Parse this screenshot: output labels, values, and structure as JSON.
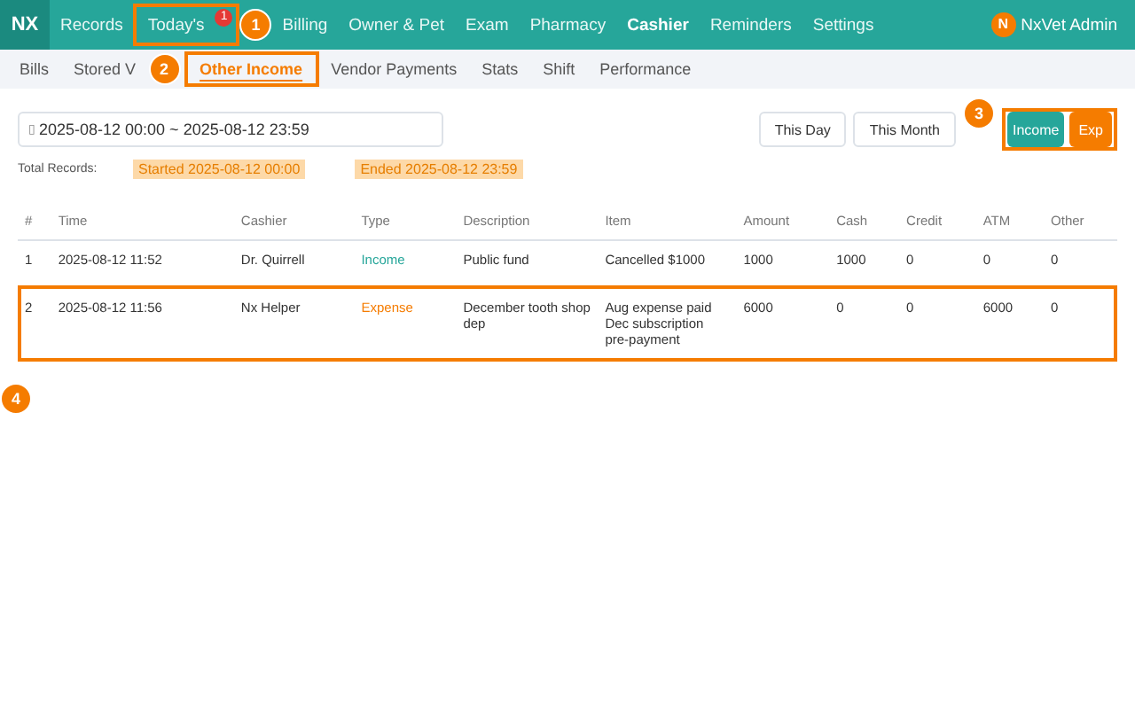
{
  "navbar": {
    "logo": "NX",
    "items": [
      {
        "label": "Records",
        "selected": false
      },
      {
        "label": "Today's",
        "selected": false,
        "badge": "1"
      },
      {
        "label": "Billing",
        "selected": false
      },
      {
        "label": "Owner & Pet",
        "selected": false
      },
      {
        "label": "Exam",
        "selected": false
      },
      {
        "label": "Pharmacy",
        "selected": false
      },
      {
        "label": "Cashier",
        "selected": true
      },
      {
        "label": "Reminders",
        "selected": false
      },
      {
        "label": "Settings",
        "selected": false
      }
    ],
    "user": {
      "initial": "N",
      "name": "NxVet Admin"
    }
  },
  "subtabs": [
    {
      "label": "Bills",
      "selected": false
    },
    {
      "label": "Stored V",
      "selected": false
    },
    {
      "label": "Other Income",
      "selected": true
    },
    {
      "label": "Vendor Payments",
      "selected": false
    },
    {
      "label": "Stats",
      "selected": false
    },
    {
      "label": "Shift",
      "selected": false
    },
    {
      "label": "Performance",
      "selected": false
    }
  ],
  "date_range": {
    "icon": "▯",
    "value": "2025-08-12 00:00 ~ 2025-08-12 23:59"
  },
  "quick_buttons": [
    {
      "label": "This Day",
      "kind": "plain"
    },
    {
      "label": "This Month",
      "kind": "plain"
    },
    {
      "label": "Income",
      "kind": "income"
    },
    {
      "label": "Exp",
      "kind": "expense"
    }
  ],
  "summary": {
    "label": "Total Records:",
    "tags": [
      "Started 2025-08-12 00:00",
      "Ended 2025-08-12 23:59"
    ]
  },
  "table": {
    "columns": [
      "#",
      "Time",
      "Cashier",
      "Type",
      "Description",
      "Item",
      "Amount",
      "Cash",
      "Credit",
      "ATM",
      "Other"
    ],
    "rows": [
      {
        "cells": [
          "1",
          "2025-08-12 11:52",
          "Dr. Quirrell",
          "Income",
          "Public fund",
          "Cancelled $1000",
          "1000",
          "1000",
          "0",
          "0",
          "0"
        ],
        "kind": "income"
      },
      {
        "cells": [
          "2",
          "2025-08-12 11:56",
          "Nx Helper",
          "Expense",
          "December tooth shop dep",
          "Aug expense paid Dec subscription pre-payment",
          "6000",
          "0",
          "0",
          "6000",
          "0"
        ],
        "kind": "expense"
      }
    ]
  },
  "annotations": [
    "1",
    "2",
    "3",
    "4"
  ]
}
